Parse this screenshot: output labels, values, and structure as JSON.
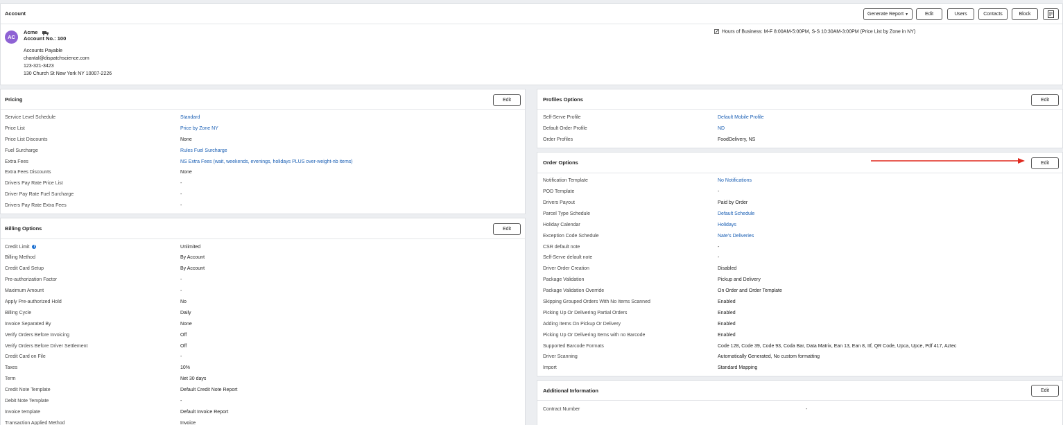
{
  "account": {
    "title": "Account",
    "buttons": {
      "generate_report": "Generate Report",
      "edit": "Edit",
      "users": "Users",
      "contacts": "Contacts",
      "block": "Block"
    },
    "avatar_initials": "AC",
    "name": "Acme",
    "account_no": "Account No.: 100",
    "hours": "Hours of Business: M-F 8:00AM-5:00PM, S-S 10:30AM-3:00PM (Price List by Zone in NY)",
    "contact_title": "Accounts Payable",
    "email": "chantal@dispatchscience.com",
    "phone": "123-321-3423",
    "address": "130 Church St New York NY 10007-2226"
  },
  "pricing": {
    "title": "Pricing",
    "edit": "Edit",
    "rows": [
      {
        "label": "Service Level Schedule",
        "value": "Standard"
      },
      {
        "label": "Price List",
        "value": "Price by Zone NY"
      },
      {
        "label": "Price List Discounts",
        "value": "None"
      },
      {
        "label": "Fuel Surcharge",
        "value": "Rules Fuel Surcharge"
      },
      {
        "label": "Extra Fees",
        "value": "NS Extra Fees (wait, weekends, evenings, holidays PLUS over-weight-nb items)"
      },
      {
        "label": "Extra Fees Discounts",
        "value": "None"
      },
      {
        "label": "Drivers Pay Rate Price List",
        "value": "-"
      },
      {
        "label": "Driver Pay Rate Fuel Surcharge",
        "value": "-"
      },
      {
        "label": "Drivers Pay Rate Extra Fees",
        "value": "-"
      }
    ]
  },
  "billing": {
    "title": "Billing Options",
    "edit": "Edit",
    "rows": [
      {
        "label": "Credit Limit",
        "value": "Unlimited"
      },
      {
        "label": "Billing Method",
        "value": "By Account"
      },
      {
        "label": "Credit Card Setup",
        "value": "By Account"
      },
      {
        "label": "Pre-authorization Factor",
        "value": "-"
      },
      {
        "label": "Maximum Amount",
        "value": "-"
      },
      {
        "label": "Apply Pre-authorized Hold",
        "value": "No"
      },
      {
        "label": "Billing Cycle",
        "value": "Daily"
      },
      {
        "label": "Invoice Separated By",
        "value": "None"
      },
      {
        "label": "Verify Orders Before Invoicing",
        "value": "Off"
      },
      {
        "label": "Verify Orders Before Driver Settlement",
        "value": "Off"
      },
      {
        "label": "Credit Card on File",
        "value": "-"
      },
      {
        "label": "Taxes",
        "value": "10%"
      },
      {
        "label": "Term",
        "value": "Net 30 days"
      },
      {
        "label": "Credit Note Template",
        "value": "Default Credit Note Report"
      },
      {
        "label": "Debit Note Template",
        "value": "-"
      },
      {
        "label": "Invoice template",
        "value": "Default Invoice Report"
      },
      {
        "label": "Transaction Applied Method",
        "value": "Invoice"
      }
    ]
  },
  "profiles": {
    "title": "Profiles Options",
    "edit": "Edit",
    "rows": [
      {
        "label": "Self-Serve Profile",
        "value": "Default Mobile Profile"
      },
      {
        "label": "Default Order Profile",
        "value": "ND"
      },
      {
        "label": "Order Profiles",
        "value": "FoodDelivery, NS"
      }
    ]
  },
  "order_options": {
    "title": "Order Options",
    "edit": "Edit",
    "rows": [
      {
        "label": "Notification Template",
        "value": "No Notifications"
      },
      {
        "label": "POD Template",
        "value": "-"
      },
      {
        "label": "Drivers Payout",
        "value": "Paid by Order"
      },
      {
        "label": "Parcel Type Schedule",
        "value": "Default Schedule"
      },
      {
        "label": "Holiday Calendar",
        "value": "Holidays"
      },
      {
        "label": "Exception Code Schedule",
        "value": "Nate's Deliveries"
      },
      {
        "label": "CSR default note",
        "value": "-"
      },
      {
        "label": "Self-Serve default note",
        "value": "-"
      },
      {
        "label": "Driver Order Creation",
        "value": "Disabled"
      },
      {
        "label": "Package Validation",
        "value": "Pickup and Delivery"
      },
      {
        "label": "Package Validation Override",
        "value": "On Order and Order Template"
      },
      {
        "label": "Skipping Grouped Orders With No Items Scanned",
        "value": "Enabled"
      },
      {
        "label": "Picking Up Or Delivering Partial Orders",
        "value": "Enabled"
      },
      {
        "label": "Adding Items On Pickup Or Delivery",
        "value": "Enabled"
      },
      {
        "label": "Picking Up Or Delivering Items with no Barcode",
        "value": "Enabled"
      },
      {
        "label": "Supported Barcode Formats",
        "value": "Code 128, Code 39, Code 93, Coda Bar, Data Matrix, Ean 13, Ean 8, Itf, QR Code, Upca, Upce, Pdf 417, Aztec"
      },
      {
        "label": "Driver Scanning",
        "value": "Automatically Generated, No custom formatting"
      },
      {
        "label": "Import",
        "value": "Standard Mapping"
      }
    ]
  },
  "additional": {
    "title": "Additional Information",
    "edit": "Edit",
    "rows": [
      {
        "label": "Contract Number",
        "value": "-"
      }
    ]
  },
  "colors": {
    "link": "#1a5fb4",
    "avatar": "#8e62d4",
    "arrow": "#e02a1f"
  }
}
